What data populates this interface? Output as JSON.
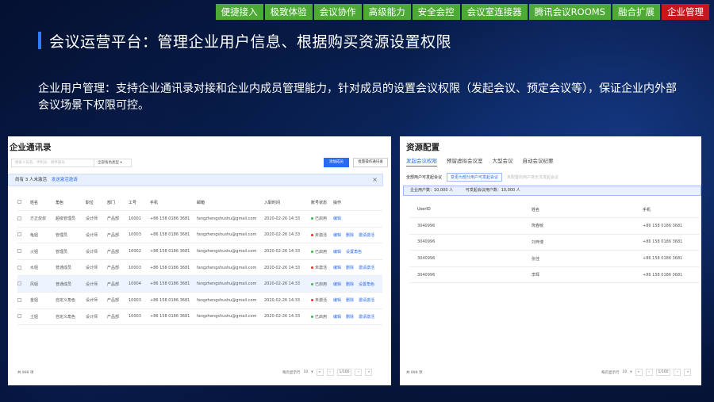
{
  "nav": [
    "便捷接入",
    "极致体验",
    "会议协作",
    "高级能力",
    "安全会控",
    "会议室连接器",
    "腾讯会议ROOMS",
    "融合扩展",
    "企业管理"
  ],
  "nav_active_index": 8,
  "page_title": "会议运营平台：管理企业用户信息、根据购买资源设置权限",
  "description": "企业用户管理：支持企业通讯录对接和企业内成员管理能力，针对成员的设置会议权限（发起会议、预定会议等），保证企业内外部会议场景下权限可控。",
  "left": {
    "title": "企业通讯录",
    "search_placeholder": "搜索人员名、手机号、邮件账号",
    "role_filter": "全部角色类型",
    "add_button": "添加成员",
    "batch_button": "批量操作通讯录",
    "notice": "尚有 3 人未激活",
    "notice_link": "发送激活邀请",
    "notice_close": "×",
    "headers": [
      "姓名",
      "角色",
      "职位",
      "部门",
      "工号",
      "手机",
      "邮箱",
      "入职时间",
      "账号状态",
      "操作"
    ],
    "rows": [
      {
        "name": "方正叔叔",
        "role": "超级管理员",
        "pos": "设计师",
        "dept": "产品部",
        "id": "10001",
        "phone": "+86 158 0186 3681",
        "email": "fangzhengshushu@gmail.com",
        "date": "2020-02-26 14:33",
        "status": "已启用",
        "ops": [
          "编辑"
        ]
      },
      {
        "name": "龟姐",
        "role": "管理员",
        "pos": "设计师",
        "dept": "产品部",
        "id": "10003",
        "phone": "+86 158 0186 3681",
        "email": "fangzhengshushu@gmail.com",
        "date": "2020-02-26 14:33",
        "status": "未激活",
        "ops": [
          "编辑",
          "删除",
          "邀请激活"
        ]
      },
      {
        "name": "火姐",
        "role": "管理员",
        "pos": "设计师",
        "dept": "产品部",
        "id": "10002",
        "phone": "+86 158 0186 3681",
        "email": "fangzhengshushu@gmail.com",
        "date": "2020-02-26 14:33",
        "status": "已启用",
        "ops": [
          "编辑",
          "设置角色"
        ]
      },
      {
        "name": "水姐",
        "role": "普通成员",
        "pos": "设计师",
        "dept": "产品部",
        "id": "10003",
        "phone": "+86 158 0186 3681",
        "email": "fangzhengshushu@gmail.com",
        "date": "2020-02-26 14:33",
        "status": "未激活",
        "ops": [
          "编辑",
          "删除",
          "邀请激活"
        ]
      },
      {
        "name": "风姐",
        "role": "普通成员",
        "pos": "设计师",
        "dept": "产品部",
        "id": "10004",
        "phone": "+86 158 0186 3681",
        "email": "fangzhengshushu@gmail.com",
        "date": "2020-02-26 14:33",
        "status": "已启用",
        "ops": [
          "编辑",
          "删除",
          "设置角色"
        ]
      },
      {
        "name": "金姐",
        "role": "自定义角色",
        "pos": "设计师",
        "dept": "产品部",
        "id": "10003",
        "phone": "+86 158 0186 3681",
        "email": "fangzhengshushu@gmail.com",
        "date": "2020-02-26 14:33",
        "status": "未激活",
        "ops": [
          "编辑",
          "删除",
          "邀请激活"
        ]
      },
      {
        "name": "土姐",
        "role": "自定义角色",
        "pos": "设计师",
        "dept": "产品部",
        "id": "10003",
        "phone": "+86 158 0186 3681",
        "email": "fangzhengshushu@gmail.com",
        "date": "2020-02-26 14:33",
        "status": "已启用",
        "ops": [
          "编辑",
          "删除",
          "邀请激活"
        ]
      }
    ],
    "total": "共 999 项",
    "per_page_label": "每页显示行",
    "per_page": "10",
    "page": "1/100"
  },
  "right": {
    "title": "资源配置",
    "tabs": [
      "发起会议权限",
      "预留虚拟会议室",
      "大型会议",
      "自动会议纪要"
    ],
    "opt1": "全部用户可发起会议",
    "opt2": "变更为部分用户可发起会议",
    "opt3": "未配置的用户将无法发起会议",
    "quota1": "企业用户数：10,000 人",
    "quota2": "可发起会议用户数：10,000 人",
    "headers": [
      "UserID",
      "姓名",
      "手机"
    ],
    "rows": [
      {
        "uid": "3040996",
        "name": "熊春敏",
        "phone": "+86 158 0186 3681"
      },
      {
        "uid": "3040996",
        "name": "刘梓博",
        "phone": "+86 158 0186 3681"
      },
      {
        "uid": "3040996",
        "name": "张佳",
        "phone": "+86 158 0186 3681"
      },
      {
        "uid": "3040996",
        "name": "李辉",
        "phone": "+86 158 0186 3681"
      }
    ],
    "total": "共 999 项",
    "per_page_label": "每页显示行",
    "per_page": "10",
    "page": "1/100"
  },
  "colors": {
    "nav": "#4dab35",
    "nav_active": "#c8161d",
    "accent": "#2a6cf0",
    "ok": "#3bb54a",
    "warn": "#e0342b"
  }
}
